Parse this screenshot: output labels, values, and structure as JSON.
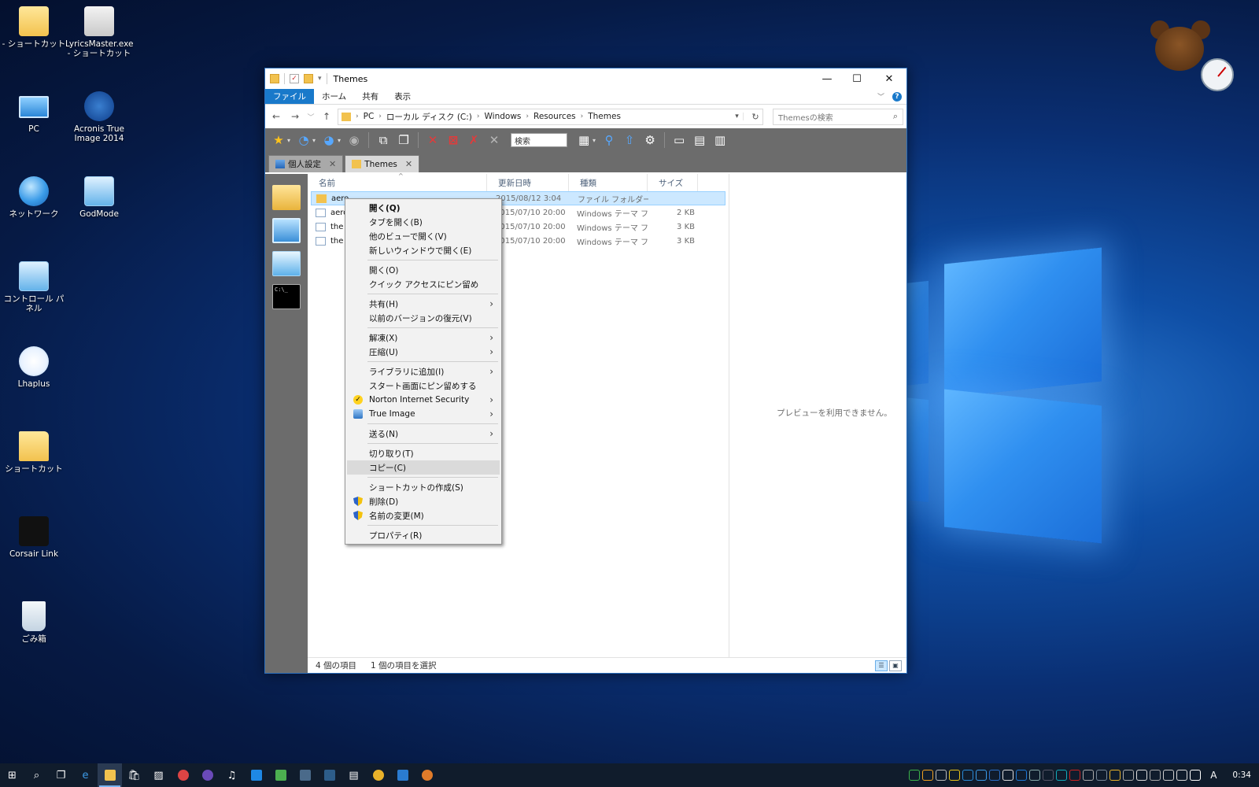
{
  "desktop": {
    "icons": [
      {
        "label": "- ショートカット",
        "icon": "user-folder-icon"
      },
      {
        "label": "LyricsMaster.exe - ショートカット",
        "icon": "lyricsmaster-icon"
      },
      {
        "label": "PC",
        "icon": "pc-icon"
      },
      {
        "label": "Acronis True Image 2014",
        "icon": "acronis-icon"
      },
      {
        "label": "ネットワーク",
        "icon": "network-icon"
      },
      {
        "label": "GodMode",
        "icon": "control-panel-icon"
      },
      {
        "label": "コントロール パネル",
        "icon": "control-panel-icon"
      },
      {
        "label": "Lhaplus",
        "icon": "lhaplus-icon"
      },
      {
        "label": "ショートカット",
        "icon": "folder-shortcut-icon"
      },
      {
        "label": "Corsair Link",
        "icon": "corsair-icon"
      },
      {
        "label": "ごみ箱",
        "icon": "recycle-bin-icon"
      }
    ]
  },
  "window": {
    "title": "Themes",
    "controls": {
      "minimize": "—",
      "maximize": "☐",
      "close": "✕"
    },
    "ribbon_tabs": [
      "ファイル",
      "ホーム",
      "共有",
      "表示"
    ],
    "address": {
      "crumbs": [
        "PC",
        "ローカル ディスク (C:)",
        "Windows",
        "Resources",
        "Themes"
      ],
      "search_placeholder": "Themesの検索"
    },
    "toolbar_search": "検索",
    "tabs": [
      {
        "label": "個人設定",
        "icon": "personalize-icon",
        "active": false
      },
      {
        "label": "Themes",
        "icon": "folder-icon",
        "active": true
      }
    ],
    "columns": [
      "名前",
      "更新日時",
      "種類",
      "サイズ"
    ],
    "files": [
      {
        "name": "aero",
        "date": "2015/08/12 3:04",
        "type": "ファイル フォルダー",
        "size": "",
        "kind": "folder",
        "selected": true
      },
      {
        "name": "aero",
        "date": "2015/07/10 20:00",
        "type": "Windows テーマ ファ...",
        "size": "2 KB",
        "kind": "theme",
        "selected": false
      },
      {
        "name": "the",
        "date": "2015/07/10 20:00",
        "type": "Windows テーマ ファ...",
        "size": "3 KB",
        "kind": "theme",
        "selected": false
      },
      {
        "name": "the",
        "date": "2015/07/10 20:00",
        "type": "Windows テーマ ファ...",
        "size": "3 KB",
        "kind": "theme",
        "selected": false
      }
    ],
    "preview_text": "プレビューを利用できません。",
    "status": {
      "count": "4 個の項目",
      "selected": "1 個の項目を選択"
    }
  },
  "context_menu": {
    "groups": [
      [
        {
          "label": "開く(Q)",
          "bold": true
        },
        {
          "label": "タブを開く(B)"
        },
        {
          "label": "他のビューで開く(V)"
        },
        {
          "label": "新しいウィンドウで開く(E)"
        }
      ],
      [
        {
          "label": "開く(O)"
        },
        {
          "label": "クイック アクセスにピン留め"
        }
      ],
      [
        {
          "label": "共有(H)",
          "submenu": true
        },
        {
          "label": "以前のバージョンの復元(V)"
        }
      ],
      [
        {
          "label": "解凍(X)",
          "submenu": true
        },
        {
          "label": "圧縮(U)",
          "submenu": true
        }
      ],
      [
        {
          "label": "ライブラリに追加(I)",
          "submenu": true
        },
        {
          "label": "スタート画面にピン留めする"
        },
        {
          "label": "Norton Internet Security",
          "submenu": true,
          "icon": "norton-icon"
        },
        {
          "label": "True Image",
          "submenu": true,
          "icon": "true-image-icon"
        }
      ],
      [
        {
          "label": "送る(N)",
          "submenu": true
        }
      ],
      [
        {
          "label": "切り取り(T)"
        },
        {
          "label": "コピー(C)",
          "highlight": true
        }
      ],
      [
        {
          "label": "ショートカットの作成(S)"
        },
        {
          "label": "削除(D)",
          "icon": "uac-shield-icon"
        },
        {
          "label": "名前の変更(M)",
          "icon": "uac-shield-icon"
        }
      ],
      [
        {
          "label": "プロパティ(R)"
        }
      ]
    ]
  },
  "taskbar": {
    "clock": "0:34",
    "pinned": [
      "start-icon",
      "search-icon",
      "task-view-icon",
      "edge-icon",
      "explorer-icon",
      "store-icon",
      "photos-icon",
      "chrome-app-icon",
      "eye-app-icon",
      "itunes-icon",
      "hulu-icon",
      "leaf-app-icon",
      "settings-app-icon",
      "window-app-icon",
      "notepad-icon",
      "chrome-icon",
      "remote-icon",
      "chrome-canary-icon"
    ],
    "tray": [
      "link-icon",
      "q-icon",
      "bag-icon",
      "drive-icon",
      "dropbox-icon",
      "app-icon",
      "box-icon",
      "a-icon",
      "b-icon",
      "c-icon",
      "steam-icon",
      "d-icon",
      "e-icon",
      "f-icon",
      "g-icon",
      "chrome-tray-icon",
      "h-icon",
      "onedrive-icon",
      "i-icon",
      "network-tray-icon",
      "volume-icon",
      "ime-icon"
    ],
    "ime": "A"
  }
}
